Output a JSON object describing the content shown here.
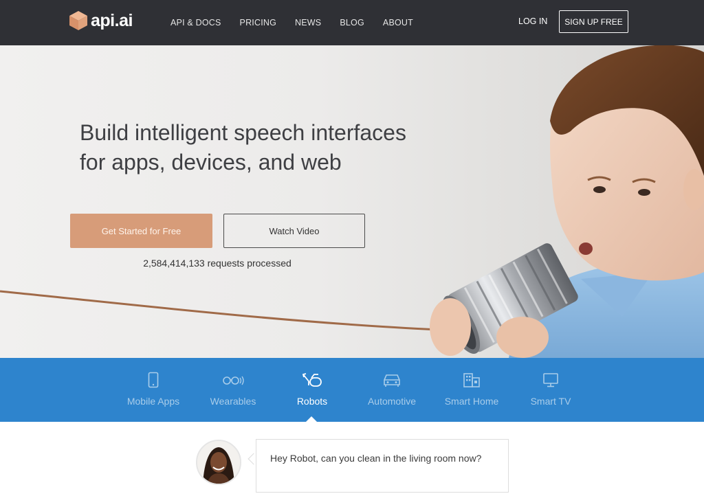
{
  "brand": {
    "name": "api.ai",
    "logo_color": "#e0a27c"
  },
  "nav": {
    "items": [
      {
        "label": "API & DOCS"
      },
      {
        "label": "PRICING"
      },
      {
        "label": "NEWS"
      },
      {
        "label": "BLOG"
      },
      {
        "label": "ABOUT"
      }
    ],
    "login_label": "LOG IN",
    "signup_label": "SIGN UP FREE"
  },
  "hero": {
    "headline_line1": "Build intelligent speech interfaces",
    "headline_line2": "for apps, devices, and web",
    "primary_cta": "Get Started for Free",
    "secondary_cta": "Watch Video",
    "requests_text": "2,584,414,133 requests processed"
  },
  "categories": {
    "accent_color": "#2e84cd",
    "items": [
      {
        "label": "Mobile Apps",
        "icon": "mobile-icon",
        "active": false
      },
      {
        "label": "Wearables",
        "icon": "glasses-icon",
        "active": false
      },
      {
        "label": "Robots",
        "icon": "robot-icon",
        "active": true
      },
      {
        "label": "Automotive",
        "icon": "car-icon",
        "active": false
      },
      {
        "label": "Smart Home",
        "icon": "home-icon",
        "active": false
      },
      {
        "label": "Smart TV",
        "icon": "tv-icon",
        "active": false
      }
    ]
  },
  "chat": {
    "message": "Hey Robot, can you clean in the living room now?"
  }
}
